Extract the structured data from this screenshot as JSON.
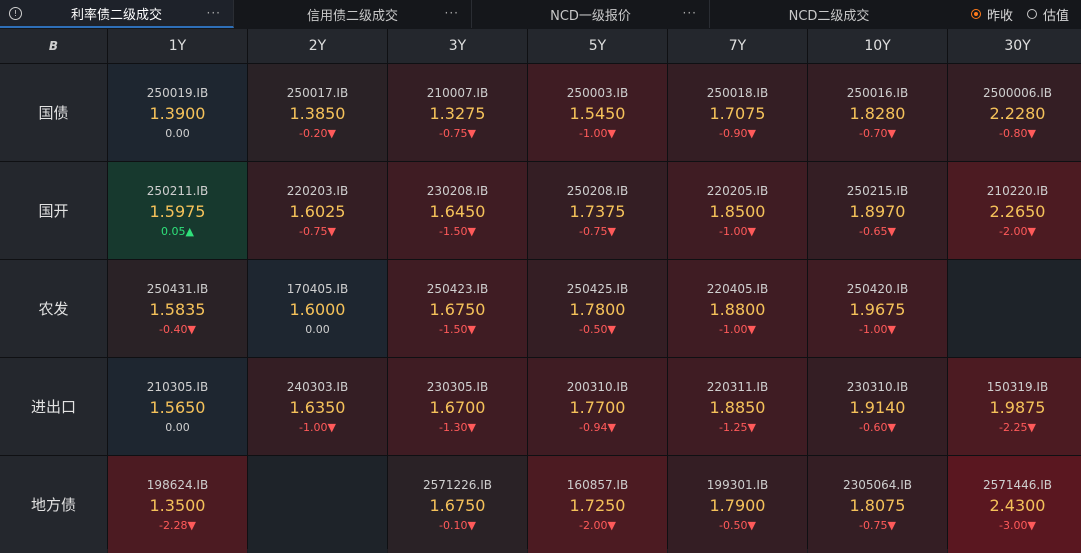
{
  "tabs": [
    {
      "label": "利率债二级成交",
      "more": "···",
      "active": true
    },
    {
      "label": "信用债二级成交",
      "more": "···",
      "active": false
    },
    {
      "label": "NCD一级报价",
      "more": "···",
      "active": false
    },
    {
      "label": "NCD二级成交",
      "more": "",
      "active": false
    }
  ],
  "info_icon": "!",
  "radios": [
    {
      "label": "昨收",
      "checked": true
    },
    {
      "label": "估值",
      "checked": false
    }
  ],
  "corner_icon": "B",
  "columns": [
    "1Y",
    "2Y",
    "3Y",
    "5Y",
    "7Y",
    "10Y",
    "30Y"
  ],
  "rows": [
    {
      "label": "国债",
      "cells": [
        {
          "code": "250019.IB",
          "rate": "1.3900",
          "chg": "0.00",
          "dir": "flat",
          "bg": "neutral"
        },
        {
          "code": "250017.IB",
          "rate": "1.3850",
          "chg": "-0.20▼",
          "dir": "down",
          "bg": "r1"
        },
        {
          "code": "210007.IB",
          "rate": "1.3275",
          "chg": "-0.75▼",
          "dir": "down",
          "bg": "r2"
        },
        {
          "code": "250003.IB",
          "rate": "1.5450",
          "chg": "-1.00▼",
          "dir": "down",
          "bg": "r3"
        },
        {
          "code": "250018.IB",
          "rate": "1.7075",
          "chg": "-0.90▼",
          "dir": "down",
          "bg": "r2"
        },
        {
          "code": "250016.IB",
          "rate": "1.8280",
          "chg": "-0.70▼",
          "dir": "down",
          "bg": "r2"
        },
        {
          "code": "2500006.IB",
          "rate": "2.2280",
          "chg": "-0.80▼",
          "dir": "down",
          "bg": "r2"
        }
      ]
    },
    {
      "label": "国开",
      "cells": [
        {
          "code": "250211.IB",
          "rate": "1.5975",
          "chg": "0.05▲",
          "dir": "up",
          "bg": "green"
        },
        {
          "code": "220203.IB",
          "rate": "1.6025",
          "chg": "-0.75▼",
          "dir": "down",
          "bg": "r2"
        },
        {
          "code": "230208.IB",
          "rate": "1.6450",
          "chg": "-1.50▼",
          "dir": "down",
          "bg": "r3"
        },
        {
          "code": "250208.IB",
          "rate": "1.7375",
          "chg": "-0.75▼",
          "dir": "down",
          "bg": "r2"
        },
        {
          "code": "220205.IB",
          "rate": "1.8500",
          "chg": "-1.00▼",
          "dir": "down",
          "bg": "r3"
        },
        {
          "code": "250215.IB",
          "rate": "1.8970",
          "chg": "-0.65▼",
          "dir": "down",
          "bg": "r2"
        },
        {
          "code": "210220.IB",
          "rate": "2.2650",
          "chg": "-2.00▼",
          "dir": "down",
          "bg": "r4"
        }
      ]
    },
    {
      "label": "农发",
      "cells": [
        {
          "code": "250431.IB",
          "rate": "1.5835",
          "chg": "-0.40▼",
          "dir": "down",
          "bg": "r1"
        },
        {
          "code": "170405.IB",
          "rate": "1.6000",
          "chg": "0.00",
          "dir": "flat",
          "bg": "neutral"
        },
        {
          "code": "250423.IB",
          "rate": "1.6750",
          "chg": "-1.50▼",
          "dir": "down",
          "bg": "r3"
        },
        {
          "code": "250425.IB",
          "rate": "1.7800",
          "chg": "-0.50▼",
          "dir": "down",
          "bg": "r2"
        },
        {
          "code": "220405.IB",
          "rate": "1.8800",
          "chg": "-1.00▼",
          "dir": "down",
          "bg": "r3"
        },
        {
          "code": "250420.IB",
          "rate": "1.9675",
          "chg": "-1.00▼",
          "dir": "down",
          "bg": "r3"
        },
        {
          "code": "",
          "rate": "",
          "chg": "",
          "dir": "flat",
          "bg": "empty"
        }
      ]
    },
    {
      "label": "进出口",
      "cells": [
        {
          "code": "210305.IB",
          "rate": "1.5650",
          "chg": "0.00",
          "dir": "flat",
          "bg": "neutral"
        },
        {
          "code": "240303.IB",
          "rate": "1.6350",
          "chg": "-1.00▼",
          "dir": "down",
          "bg": "r2"
        },
        {
          "code": "230305.IB",
          "rate": "1.6700",
          "chg": "-1.30▼",
          "dir": "down",
          "bg": "r3"
        },
        {
          "code": "200310.IB",
          "rate": "1.7700",
          "chg": "-0.94▼",
          "dir": "down",
          "bg": "r3"
        },
        {
          "code": "220311.IB",
          "rate": "1.8850",
          "chg": "-1.25▼",
          "dir": "down",
          "bg": "r3"
        },
        {
          "code": "230310.IB",
          "rate": "1.9140",
          "chg": "-0.60▼",
          "dir": "down",
          "bg": "r2"
        },
        {
          "code": "150319.IB",
          "rate": "1.9875",
          "chg": "-2.25▼",
          "dir": "down",
          "bg": "r4"
        }
      ]
    },
    {
      "label": "地方债",
      "cells": [
        {
          "code": "198624.IB",
          "rate": "1.3500",
          "chg": "-2.28▼",
          "dir": "down",
          "bg": "r4"
        },
        {
          "code": "",
          "rate": "",
          "chg": "",
          "dir": "flat",
          "bg": "empty"
        },
        {
          "code": "2571226.IB",
          "rate": "1.6750",
          "chg": "-0.10▼",
          "dir": "down",
          "bg": "r1"
        },
        {
          "code": "160857.IB",
          "rate": "1.7250",
          "chg": "-2.00▼",
          "dir": "down",
          "bg": "r4"
        },
        {
          "code": "199301.IB",
          "rate": "1.7900",
          "chg": "-0.50▼",
          "dir": "down",
          "bg": "r2"
        },
        {
          "code": "2305064.IB",
          "rate": "1.8075",
          "chg": "-0.75▼",
          "dir": "down",
          "bg": "r2"
        },
        {
          "code": "2571446.IB",
          "rate": "2.4300",
          "chg": "-3.00▼",
          "dir": "down",
          "bg": "r5"
        }
      ]
    }
  ]
}
